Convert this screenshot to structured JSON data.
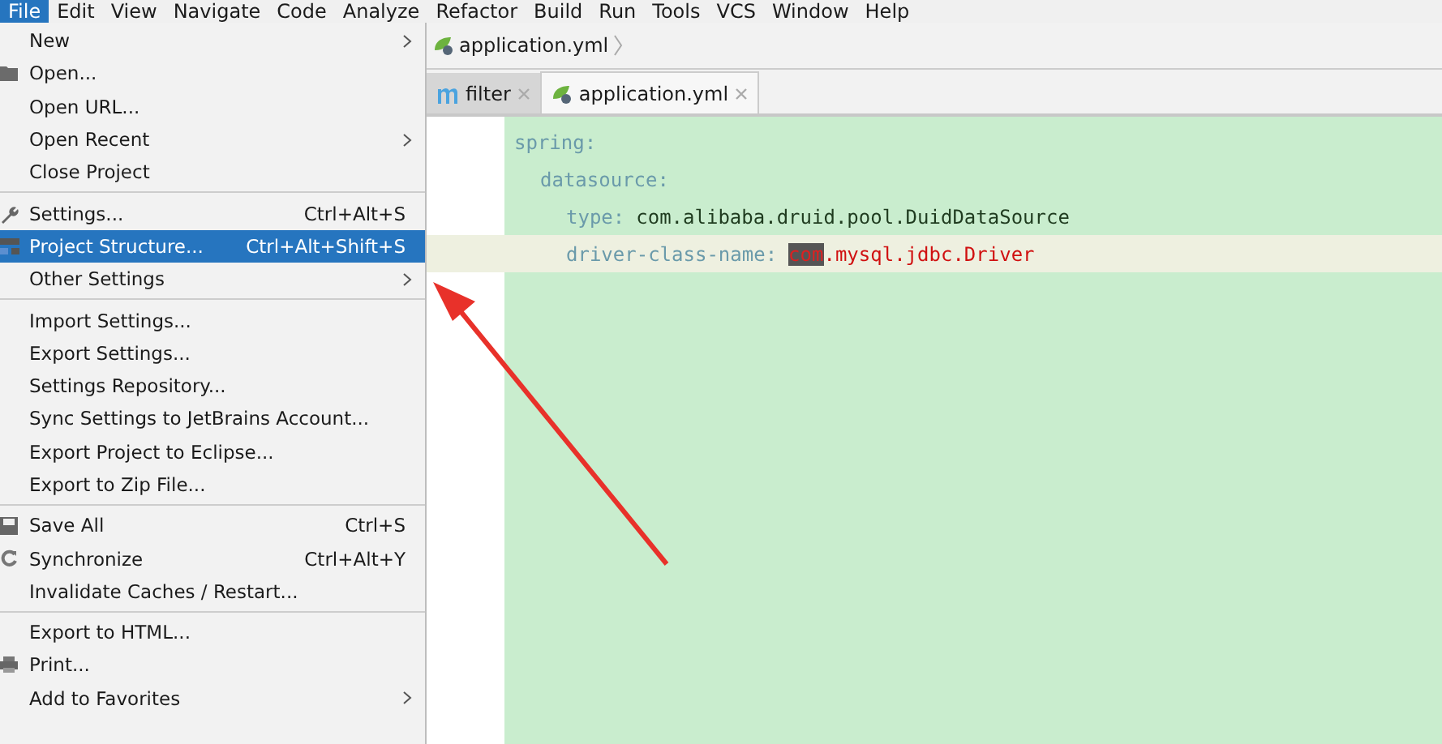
{
  "menubar": [
    {
      "label": "File",
      "selected": true
    },
    {
      "label": "Edit",
      "selected": false
    },
    {
      "label": "View",
      "selected": false
    },
    {
      "label": "Navigate",
      "selected": false
    },
    {
      "label": "Code",
      "selected": false
    },
    {
      "label": "Analyze",
      "selected": false
    },
    {
      "label": "Refactor",
      "selected": false
    },
    {
      "label": "Build",
      "selected": false
    },
    {
      "label": "Run",
      "selected": false
    },
    {
      "label": "Tools",
      "selected": false
    },
    {
      "label": "VCS",
      "selected": false
    },
    {
      "label": "Window",
      "selected": false
    },
    {
      "label": "Help",
      "selected": false
    }
  ],
  "file_menu": {
    "groups": [
      [
        {
          "label": "New",
          "submenu": true,
          "selected": false
        },
        {
          "label": "Open...",
          "kind": "folder",
          "selected": false
        },
        {
          "label": "Open URL...",
          "selected": false
        },
        {
          "label": "Open Recent",
          "submenu": true,
          "selected": false
        },
        {
          "label": "Close Project",
          "selected": false
        }
      ],
      [
        {
          "label": "Settings...",
          "kind": "wrench",
          "shortcut": "Ctrl+Alt+S",
          "selected": false
        },
        {
          "label": "Project Structure...",
          "kind": "structure",
          "shortcut": "Ctrl+Alt+Shift+S",
          "selected": true
        },
        {
          "label": "Other Settings",
          "submenu": true,
          "selected": false
        }
      ],
      [
        {
          "label": "Import Settings...",
          "selected": false
        },
        {
          "label": "Export Settings...",
          "selected": false
        },
        {
          "label": "Settings Repository...",
          "selected": false
        },
        {
          "label": "Sync Settings to JetBrains Account...",
          "selected": false
        },
        {
          "label": "Export Project to Eclipse...",
          "selected": false
        },
        {
          "label": "Export to Zip File...",
          "selected": false
        }
      ],
      [
        {
          "label": "Save All",
          "kind": "save",
          "shortcut": "Ctrl+S",
          "selected": false
        },
        {
          "label": "Synchronize",
          "kind": "sync",
          "shortcut": "Ctrl+Alt+Y",
          "selected": false
        },
        {
          "label": "Invalidate Caches / Restart...",
          "selected": false
        }
      ],
      [
        {
          "label": "Export to HTML...",
          "selected": false
        },
        {
          "label": "Print...",
          "kind": "print",
          "selected": false
        },
        {
          "label": "Add to Favorites",
          "submenu": true,
          "selected": false
        }
      ]
    ]
  },
  "breadcrumb": {
    "label": "application.yml"
  },
  "tabs": [
    {
      "label": "filter",
      "kind": "m",
      "selected": false
    },
    {
      "label": "application.yml",
      "kind": "spring",
      "selected": true
    }
  ],
  "editor": {
    "lines": [
      {
        "selected": false,
        "tokens": [
          {
            "kind": "key",
            "text": "spring:"
          }
        ]
      },
      {
        "selected": false,
        "tokens": [
          {
            "kind": "key",
            "text": "datasource:"
          }
        ]
      },
      {
        "selected": false,
        "tokens": [
          {
            "kind": "key",
            "text": "type:"
          },
          {
            "kind": "value",
            "text": "com.alibaba.druid.pool.DuidDataSource"
          }
        ]
      },
      {
        "selected": true,
        "tokens": [
          {
            "kind": "key",
            "text": "driver-class-name:"
          },
          {
            "kind": "error-highlight",
            "text": "com"
          },
          {
            "kind": "error",
            "text": ".mysql.jdbc.Driver"
          }
        ]
      }
    ]
  }
}
